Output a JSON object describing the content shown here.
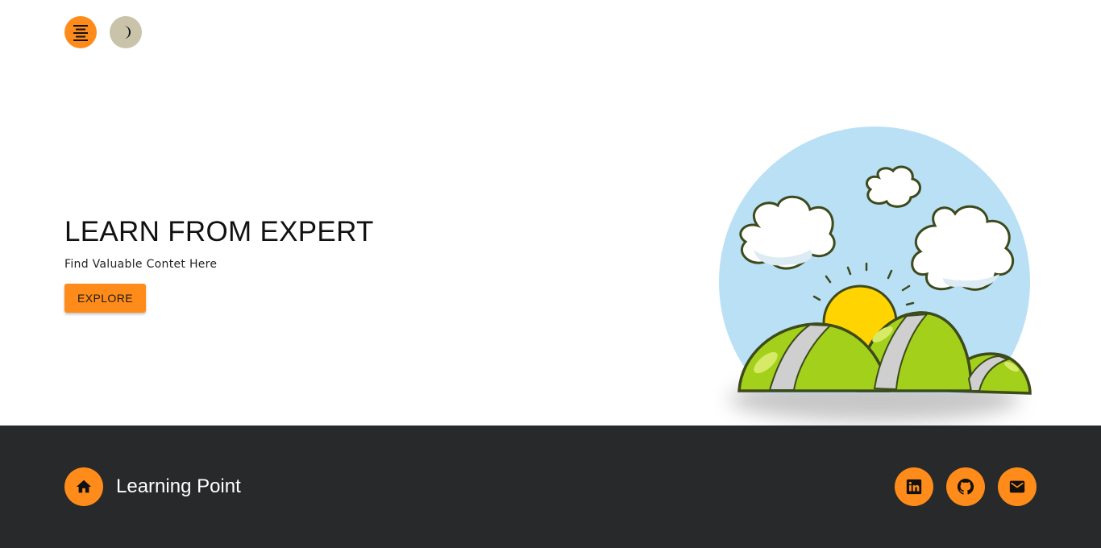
{
  "header": {
    "menu_icon": "align-center-icon",
    "theme_icon": "moon-icon"
  },
  "hero": {
    "title": "LEARN FROM EXPERT",
    "subtitle": "Find Valuable Contet Here",
    "cta_label": "EXPLORE"
  },
  "illustration": {
    "subject": "sun-hills-clouds-illustration"
  },
  "footer": {
    "home_icon": "home-icon",
    "brand": "Learning Point",
    "social": [
      {
        "icon": "linkedin-icon"
      },
      {
        "icon": "github-icon"
      },
      {
        "icon": "mail-icon"
      }
    ]
  },
  "colors": {
    "accent": "#ff8c1a",
    "theme_button": "#c8c3a9",
    "footer_bg": "#28292b",
    "sky": "#b9e0f5",
    "sun": "#ffd400",
    "hills": "#9ccf1e"
  }
}
